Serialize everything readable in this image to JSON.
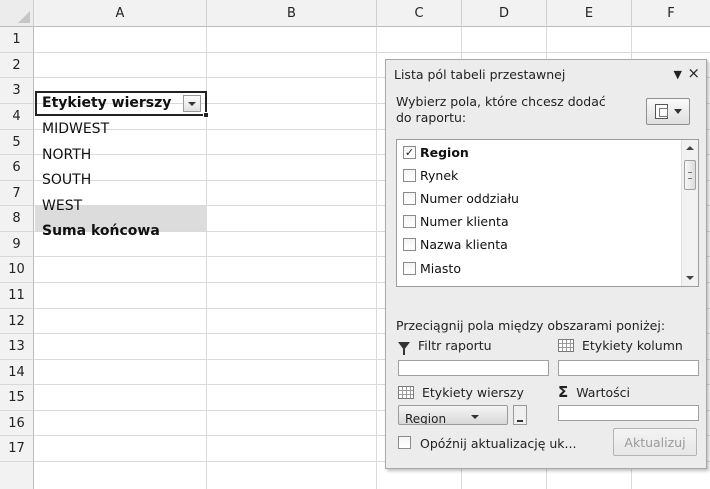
{
  "columns": [
    "A",
    "B",
    "C",
    "D",
    "E",
    "F"
  ],
  "rows": [
    "1",
    "2",
    "3",
    "4",
    "5",
    "6",
    "7",
    "8",
    "9",
    "10",
    "11",
    "12",
    "13",
    "14",
    "15",
    "16",
    "17"
  ],
  "cells": {
    "A3": "Etykiety wierszy",
    "A4": "MIDWEST",
    "A5": "NORTH",
    "A6": "SOUTH",
    "A7": "WEST",
    "A8": "Suma końcowa"
  },
  "pane": {
    "title": "Lista pól tabeli przestawnej",
    "menu_icon": "dropdown-arrow-icon",
    "close_label": "×",
    "choose_line1": "Wybierz pola, które chcesz dodać",
    "choose_line2": "do raportu:",
    "fields": [
      {
        "label": "Region",
        "checked": true
      },
      {
        "label": "Rynek",
        "checked": false
      },
      {
        "label": "Numer oddziału",
        "checked": false
      },
      {
        "label": "Numer klienta",
        "checked": false
      },
      {
        "label": "Nazwa klienta",
        "checked": false
      },
      {
        "label": "Miasto",
        "checked": false
      }
    ],
    "drag_text": "Przeciągnij pola między obszarami poniżej:",
    "areas": {
      "report_filter": "Filtr raportu",
      "column_labels": "Etykiety kolumn",
      "row_labels": "Etykiety wierszy",
      "values": "Wartości"
    },
    "row_field_pill": "Region",
    "defer_label": "Opóźnij aktualizację uk...",
    "update_label": "Aktualizuj"
  }
}
